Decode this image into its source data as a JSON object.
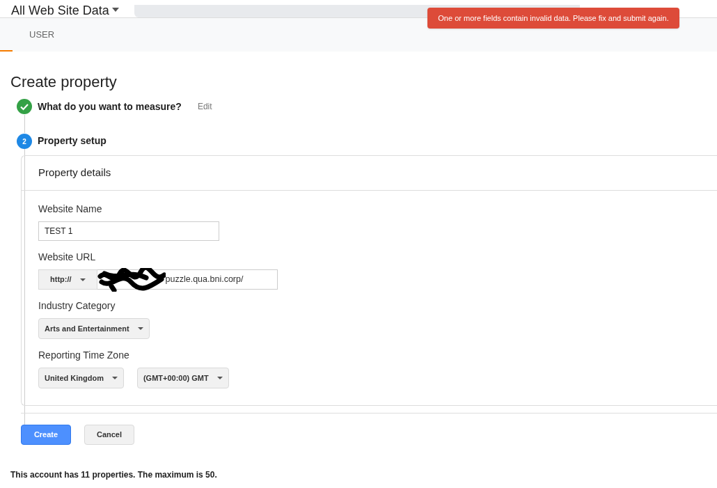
{
  "header": {
    "view_title": "All Web Site Data",
    "tab": "USER"
  },
  "toast": {
    "message": "One or more fields contain invalid data. Please fix and submit again."
  },
  "title": "Create property",
  "steps": [
    {
      "completed": true,
      "label": "What do you want to measure?",
      "action": "Edit"
    },
    {
      "completed": false,
      "number": "2",
      "label": "Property setup"
    }
  ],
  "card": {
    "title": "Property details",
    "fields": [
      {
        "kind": "text",
        "label": "Website Name",
        "value": "TEST 1"
      },
      {
        "kind": "url",
        "label": "Website URL",
        "protocol": "http://",
        "value": "puzzle.qua.bni.corp/"
      },
      {
        "kind": "select",
        "label": "Industry Category",
        "options": [
          "Arts and Entertainment"
        ]
      },
      {
        "kind": "select",
        "label": "Reporting Time Zone",
        "options": [
          "United Kingdom",
          "(GMT+00:00) GMT"
        ]
      }
    ]
  },
  "buttons": [
    {
      "label": "Create",
      "primary": true
    },
    {
      "label": "Cancel",
      "primary": false
    }
  ],
  "footer": "This account has 11 properties. The maximum is 50."
}
